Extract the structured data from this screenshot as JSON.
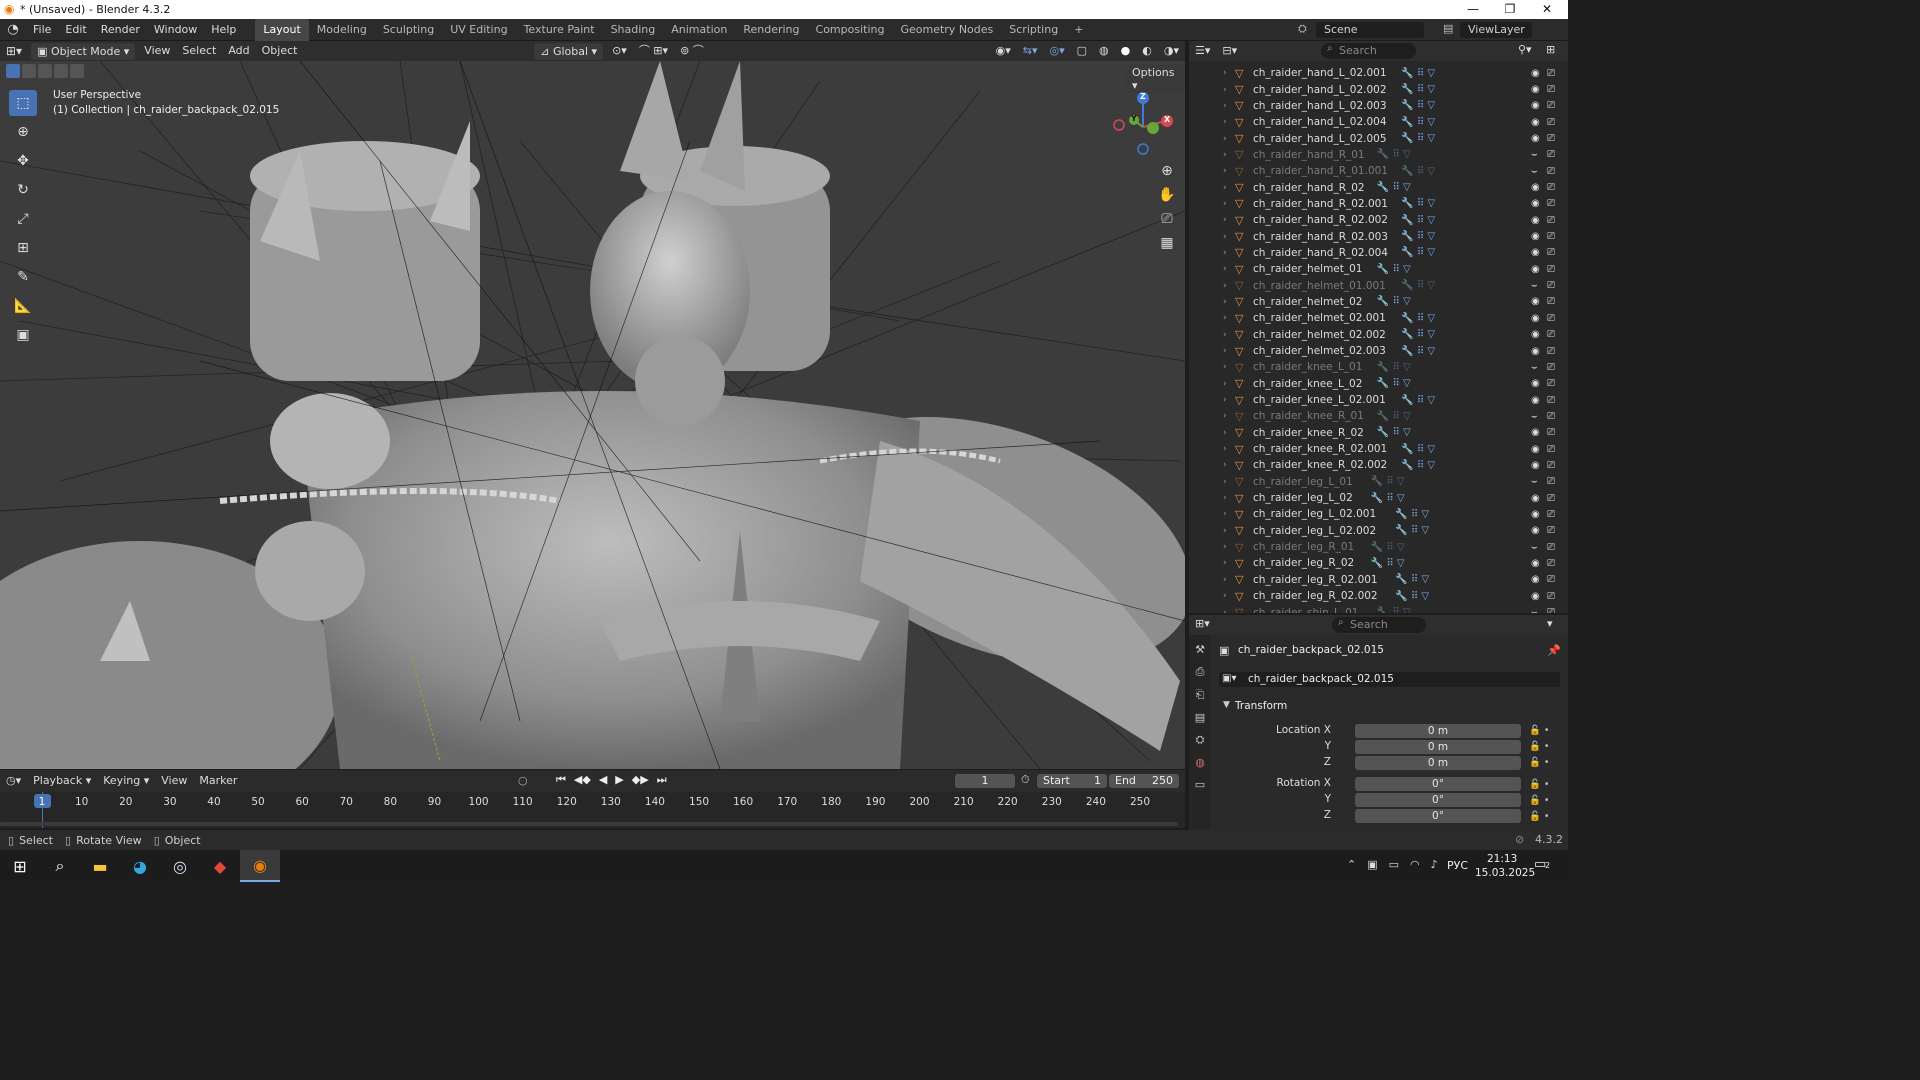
{
  "window": {
    "title": "* (Unsaved) - Blender 4.3.2",
    "minimize": "—",
    "maximize": "❐",
    "close": "✕"
  },
  "menus": [
    "File",
    "Edit",
    "Render",
    "Window",
    "Help"
  ],
  "workspaces": [
    "Layout",
    "Modeling",
    "Sculpting",
    "UV Editing",
    "Texture Paint",
    "Shading",
    "Animation",
    "Rendering",
    "Compositing",
    "Geometry Nodes",
    "Scripting"
  ],
  "active_workspace": "Layout",
  "scene": {
    "name": "Scene",
    "view_layer": "ViewLayer"
  },
  "viewport_header": {
    "mode": "Object Mode",
    "menus": [
      "View",
      "Select",
      "Add",
      "Object"
    ],
    "orientation": "Global",
    "options": "Options"
  },
  "viewport": {
    "perspective": "User Perspective",
    "collection_info": "(1) Collection | ch_raider_backpack_02.015",
    "gizmo_axes": [
      "Z",
      "Y",
      "X"
    ]
  },
  "outliner": {
    "search_placeholder": "Search",
    "rows": [
      {
        "name": "ch_raider_hand_L_02.001",
        "dim": false
      },
      {
        "name": "ch_raider_hand_L_02.002",
        "dim": false
      },
      {
        "name": "ch_raider_hand_L_02.003",
        "dim": false
      },
      {
        "name": "ch_raider_hand_L_02.004",
        "dim": false
      },
      {
        "name": "ch_raider_hand_L_02.005",
        "dim": false
      },
      {
        "name": "ch_raider_hand_R_01",
        "dim": true
      },
      {
        "name": "ch_raider_hand_R_01.001",
        "dim": true
      },
      {
        "name": "ch_raider_hand_R_02",
        "dim": false
      },
      {
        "name": "ch_raider_hand_R_02.001",
        "dim": false
      },
      {
        "name": "ch_raider_hand_R_02.002",
        "dim": false
      },
      {
        "name": "ch_raider_hand_R_02.003",
        "dim": false
      },
      {
        "name": "ch_raider_hand_R_02.004",
        "dim": false
      },
      {
        "name": "ch_raider_helmet_01",
        "dim": false
      },
      {
        "name": "ch_raider_helmet_01.001",
        "dim": true
      },
      {
        "name": "ch_raider_helmet_02",
        "dim": false
      },
      {
        "name": "ch_raider_helmet_02.001",
        "dim": false
      },
      {
        "name": "ch_raider_helmet_02.002",
        "dim": false
      },
      {
        "name": "ch_raider_helmet_02.003",
        "dim": false
      },
      {
        "name": "ch_raider_knee_L_01",
        "dim": true
      },
      {
        "name": "ch_raider_knee_L_02",
        "dim": false
      },
      {
        "name": "ch_raider_knee_L_02.001",
        "dim": false
      },
      {
        "name": "ch_raider_knee_R_01",
        "dim": true
      },
      {
        "name": "ch_raider_knee_R_02",
        "dim": false
      },
      {
        "name": "ch_raider_knee_R_02.001",
        "dim": false
      },
      {
        "name": "ch_raider_knee_R_02.002",
        "dim": false
      },
      {
        "name": "ch_raider_leg_L_01",
        "dim": true
      },
      {
        "name": "ch_raider_leg_L_02",
        "dim": false
      },
      {
        "name": "ch_raider_leg_L_02.001",
        "dim": false
      },
      {
        "name": "ch_raider_leg_L_02.002",
        "dim": false
      },
      {
        "name": "ch_raider_leg_R_01",
        "dim": true
      },
      {
        "name": "ch_raider_leg_R_02",
        "dim": false
      },
      {
        "name": "ch_raider_leg_R_02.001",
        "dim": false
      },
      {
        "name": "ch_raider_leg_R_02.002",
        "dim": false
      },
      {
        "name": "ch_raider_shin_L_01",
        "dim": true
      }
    ]
  },
  "properties": {
    "search_placeholder": "Search",
    "object_name": "ch_raider_backpack_02.015",
    "object_field": "ch_raider_backpack_02.015",
    "panel": "Transform",
    "location": {
      "label_x": "Location X",
      "label_y": "Y",
      "label_z": "Z",
      "x": "0 m",
      "y": "0 m",
      "z": "0 m"
    },
    "rotation": {
      "label_x": "Rotation X",
      "label_y": "Y",
      "label_z": "Z",
      "x": "0°",
      "y": "0°",
      "z": "0°"
    }
  },
  "timeline": {
    "menus": [
      "Playback",
      "Keying",
      "View",
      "Marker"
    ],
    "current_frame": "1",
    "start_label": "Start",
    "start": "1",
    "end_label": "End",
    "end": "250",
    "ticks": [
      "1",
      "10",
      "20",
      "30",
      "40",
      "50",
      "60",
      "70",
      "80",
      "90",
      "100",
      "110",
      "120",
      "130",
      "140",
      "150",
      "160",
      "170",
      "180",
      "190",
      "200",
      "210",
      "220",
      "230",
      "240",
      "250"
    ]
  },
  "statusbar": {
    "items": [
      "Select",
      "Rotate View",
      "Object"
    ],
    "version": "4.3.2"
  },
  "taskbar": {
    "lang": "РУС",
    "time": "21:13",
    "date": "15.03.2025",
    "notif": "2"
  },
  "colors": {
    "accent": "#4772b3",
    "object_orange": "#e8953a",
    "selected_frame": "#4772b3"
  }
}
